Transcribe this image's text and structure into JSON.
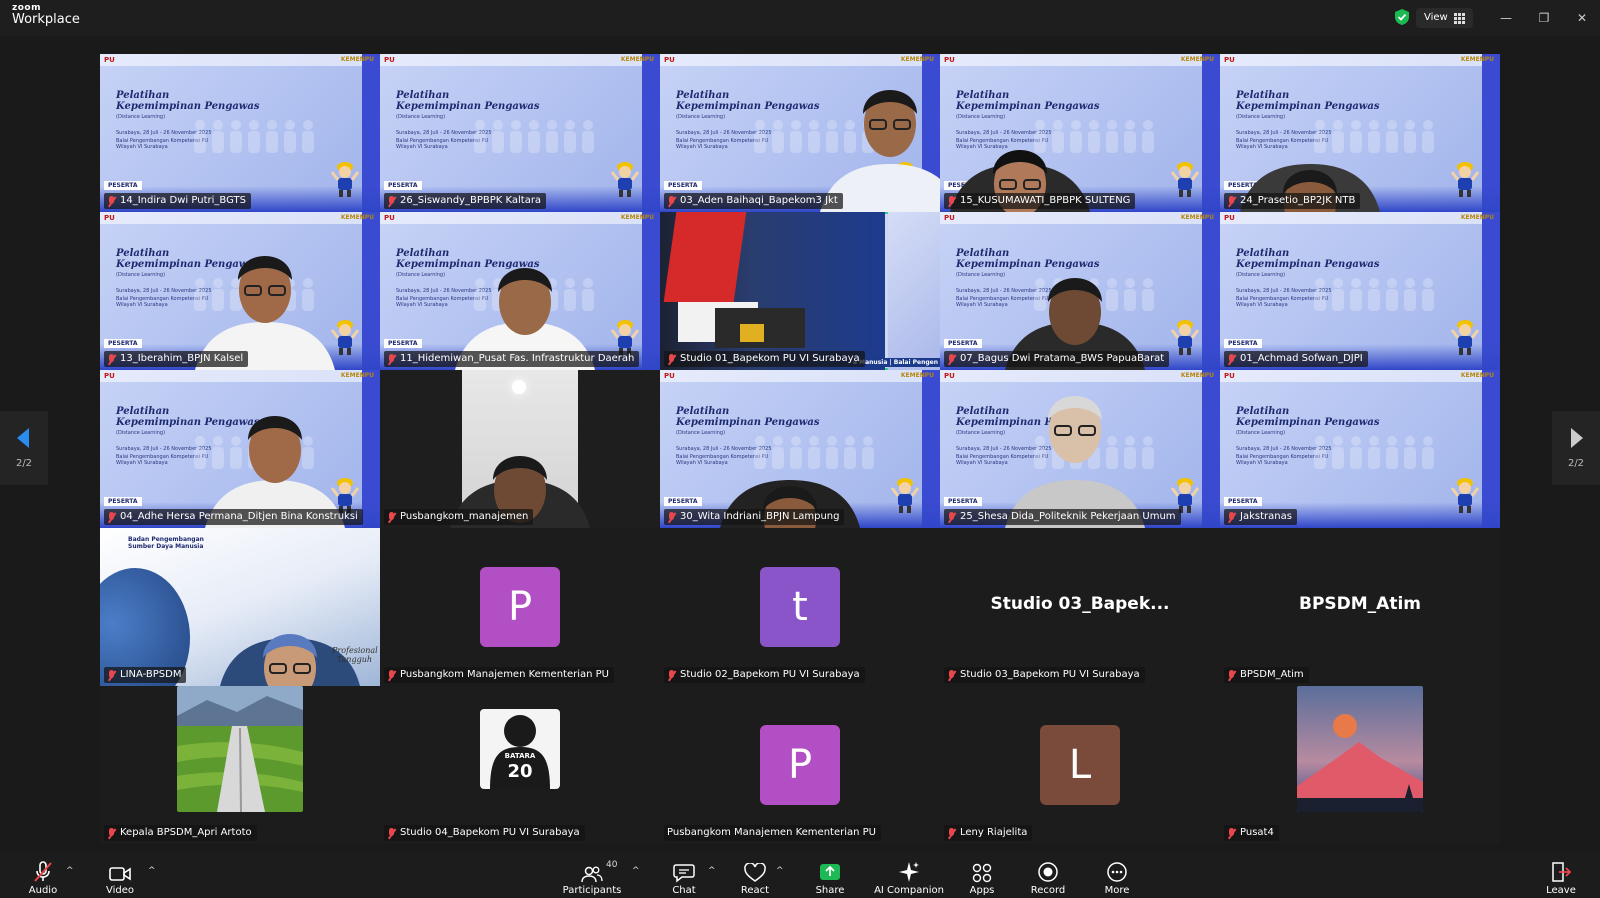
{
  "app": {
    "brand_top": "zoom",
    "brand_bottom": "Workplace",
    "view_label": "View"
  },
  "pager": {
    "left": "2/2",
    "right": "2/2"
  },
  "slide": {
    "pu": "PU",
    "kemen": "KEMENPU",
    "title_line1": "Pelatihan",
    "title_line2": "Kepemimpinan Pengawas",
    "subtitle": "(Distance Learning)",
    "dates": "Surabaya, 28 Juli - 26 November 2025",
    "org1": "Balai Pengembangan Kompetensi PU",
    "org2": "Wilayah VI Surabaya",
    "badge": "PESERTA"
  },
  "tiles": [
    {
      "name": "14_Indira Dwi Putri_BGTS",
      "kind": "slide"
    },
    {
      "name": "26_Siswandy_BPBPK Kaltara",
      "kind": "slide"
    },
    {
      "name": "03_Aden Baihaqi_Bapekom3 Jkt",
      "kind": "slide-person"
    },
    {
      "name": "15_KUSUMAWATI_BPBPK SULTENG",
      "kind": "slide-person"
    },
    {
      "name": "24_Prasetio_BP2JK NTB",
      "kind": "slide-person"
    },
    {
      "name": "13_Iberahim_BPJN Kalsel",
      "kind": "slide-person"
    },
    {
      "name": "11_Hidemiwan_Pusat Fas. Infrastruktur Daerah",
      "kind": "slide-person"
    },
    {
      "name": "Studio 01_Bapekom PU VI Surabaya",
      "kind": "studio",
      "ribbon": "a Manusia | Balai Pengen"
    },
    {
      "name": "07_Bagus Dwi Pratama_BWS PapuaBarat",
      "kind": "slide-person"
    },
    {
      "name": "01_Achmad Sofwan_DJPI",
      "kind": "slide"
    },
    {
      "name": "04_Adhe Hersa Permana_Ditjen Bina Konstruksi",
      "kind": "slide-person"
    },
    {
      "name": "Pusbangkom_manajemen",
      "kind": "camera"
    },
    {
      "name": "30_Wita Indriani_BPJN Lampung",
      "kind": "slide-person"
    },
    {
      "name": "25_Shesa Dida_Politeknik Pekerjaan Umum",
      "kind": "slide-person"
    },
    {
      "name": "Jakstranas",
      "kind": "slide"
    },
    {
      "name": "LINA-BPSDM",
      "kind": "bpsdm",
      "header": "Badan Pengembangan Sumber Daya Manusia",
      "signature": "Profesional Tangguh"
    },
    {
      "name": "Pusbangkom Manajemen Kementerian PU",
      "kind": "avatar",
      "initial": "P",
      "color": "#b34fc4"
    },
    {
      "name": "Studio 02_Bapekom PU VI Surabaya",
      "kind": "avatar",
      "initial": "t",
      "color": "#8a55c9"
    },
    {
      "name": "Studio 03_Bapekom PU VI Surabaya",
      "kind": "text",
      "display": "Studio 03_Bapek..."
    },
    {
      "name": "BPSDM_Atim",
      "kind": "text",
      "display": "BPSDM_Atim"
    },
    {
      "name": "Kepala BPSDM_Apri Artoto",
      "kind": "photo-road"
    },
    {
      "name": "Studio 04_Bapekom PU VI Surabaya",
      "kind": "photo-jersey",
      "jersey_text": "BATARA",
      "jersey_number": "20"
    },
    {
      "name": "Pusbangkom Manajemen Kementerian PU",
      "kind": "avatar",
      "initial": "P",
      "color": "#b34fc4",
      "unmuted": true
    },
    {
      "name": "Leny Riajelita",
      "kind": "avatar",
      "initial": "L",
      "color": "#7a4a3a"
    },
    {
      "name": "Pusat4",
      "kind": "photo-sunset"
    }
  ],
  "toolbar": {
    "audio": "Audio",
    "video": "Video",
    "participants": "Participants",
    "participants_count": "40",
    "chat": "Chat",
    "react": "React",
    "share": "Share",
    "companion": "AI Companion",
    "apps": "Apps",
    "record": "Record",
    "more": "More",
    "leave": "Leave"
  },
  "colors": {
    "active_speaker": "#2fd18a",
    "share_green": "#1db954",
    "leave_red": "#e8474b",
    "muted_red": "#e8474b"
  }
}
